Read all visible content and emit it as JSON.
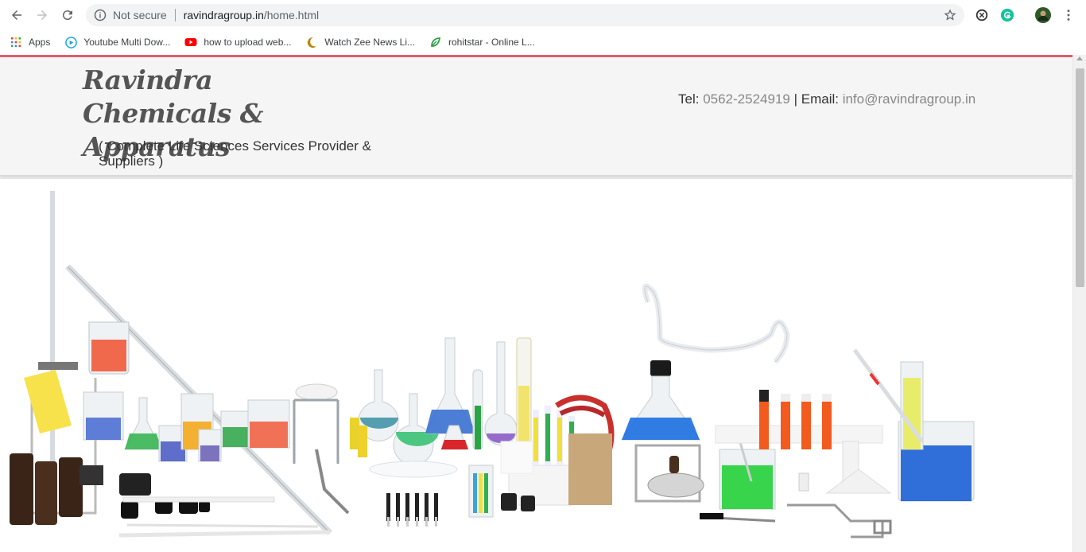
{
  "browser": {
    "not_secure": "Not secure",
    "url_host": "ravindragroup.in",
    "url_path": "/home.html",
    "bookmarks": [
      {
        "label": "Apps",
        "icon": "apps-grid-icon"
      },
      {
        "label": "Youtube Multi Dow...",
        "icon": "download-icon"
      },
      {
        "label": "how to upload web...",
        "icon": "youtube-icon"
      },
      {
        "label": "Watch Zee News Li...",
        "icon": "moon-logo-icon"
      },
      {
        "label": "rohitstar - Online L...",
        "icon": "leaf-logo-icon"
      }
    ]
  },
  "header": {
    "brand": "Ravindra Chemicals & Apparatus",
    "tagline": "( Complete Life Sciences Services Provider & Suppliers )",
    "tel_label": "Tel: ",
    "tel_value": "0562-2524919",
    "divider": " | ",
    "email_label": "Email: ",
    "email_value": "info@ravindragroup.in"
  },
  "colors": {
    "accent_line": "#e25d6d",
    "header_bg": "#f5f5f5"
  }
}
